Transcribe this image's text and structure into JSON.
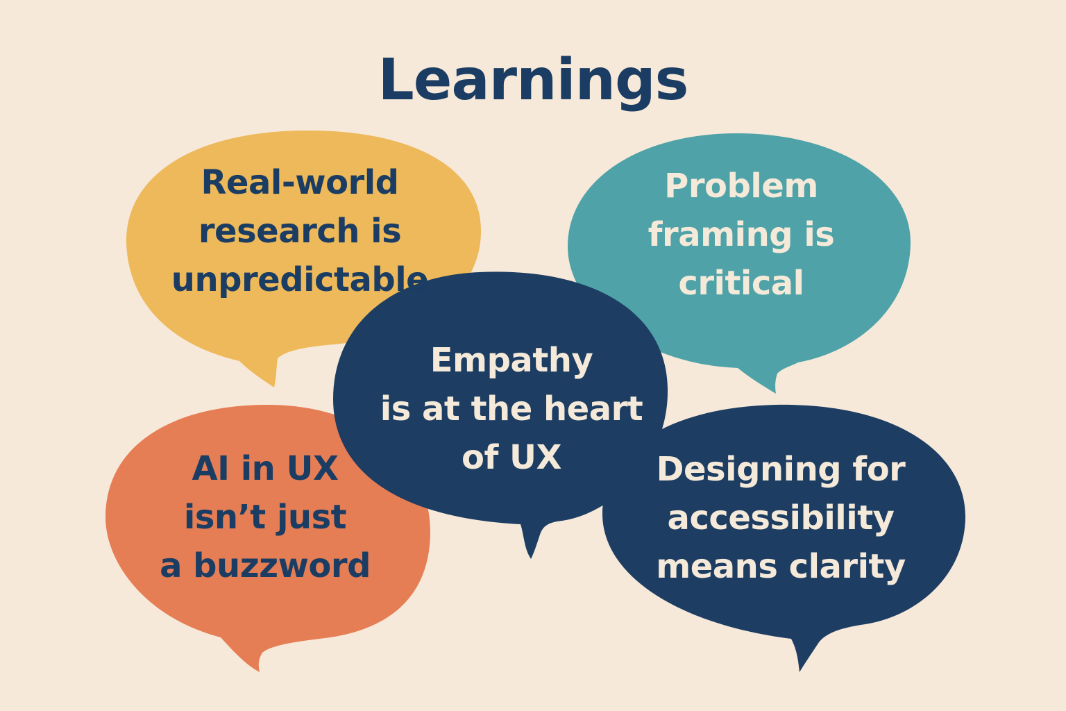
{
  "title": "Learnings",
  "colors": {
    "background": "#f7e9da",
    "title": "#1b3d63",
    "dark_text": "#1b3d63",
    "light_text": "#f5ead9",
    "yellow": "#edb95a",
    "teal": "#4fa3a8",
    "navy": "#1d3d62",
    "orange": "#e67e55"
  },
  "bubbles": [
    {
      "id": "research",
      "lines": [
        "Real-world",
        "research is",
        "unpredictable"
      ],
      "fill_key": "yellow",
      "text_key": "dark_text"
    },
    {
      "id": "framing",
      "lines": [
        "Problem",
        "framing is",
        "critical"
      ],
      "fill_key": "teal",
      "text_key": "light_text"
    },
    {
      "id": "ai",
      "lines": [
        "AI in UX",
        "isn’t just",
        "a buzzword"
      ],
      "fill_key": "orange",
      "text_key": "dark_text"
    },
    {
      "id": "empathy",
      "lines": [
        "Empathy",
        "is at the heart",
        "of UX"
      ],
      "fill_key": "navy",
      "text_key": "light_text"
    },
    {
      "id": "accessibility",
      "lines": [
        "Designing for",
        "accessibility",
        "means clarity"
      ],
      "fill_key": "navy",
      "text_key": "light_text"
    }
  ]
}
